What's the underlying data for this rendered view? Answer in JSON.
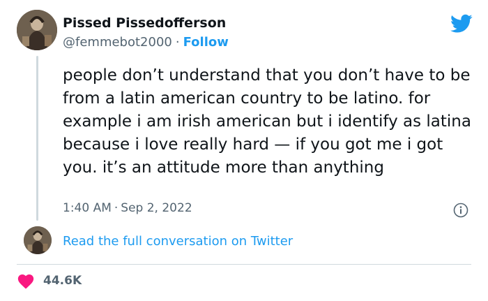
{
  "author": {
    "name": "Pissed Pissedofferson",
    "handle": "@femmebot2000",
    "separator": "·",
    "follow_label": "Follow"
  },
  "tweet": {
    "text": "people don’t understand that you don’t have to be from a latin american country to be latino. for example i am irish american but i identify as latina because i love really hard — if you got me i got you. it’s an attitude more than anything",
    "time": "1:40 AM",
    "separator": "·",
    "date": "Sep 2, 2022"
  },
  "conversation_link": "Read the full conversation on Twitter",
  "likes": {
    "count": "44.6K"
  },
  "icons": {
    "brand": "twitter-bird-icon",
    "info": "info-icon",
    "like": "heart-icon"
  },
  "colors": {
    "accent": "#1d9bf0",
    "heart": "#f91880",
    "secondary_text": "#536471",
    "divider": "#cfd9de"
  }
}
